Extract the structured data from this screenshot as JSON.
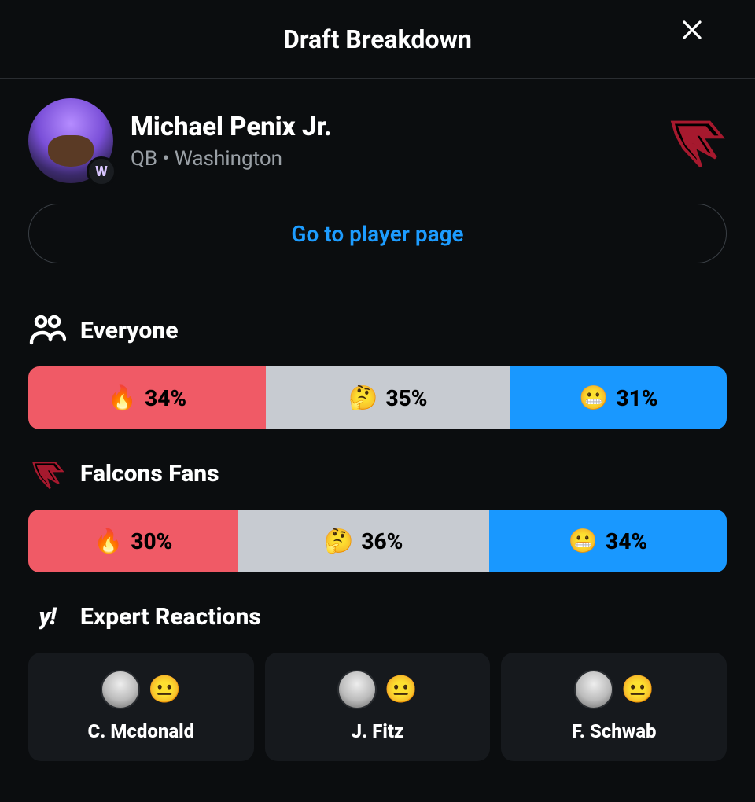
{
  "header": {
    "title": "Draft Breakdown"
  },
  "player": {
    "name": "Michael Penix Jr.",
    "subtitle": "QB • Washington",
    "college_badge": "W",
    "page_button": "Go to player page"
  },
  "polls": {
    "everyone_label": "Everyone",
    "everyone": {
      "hot": "34%",
      "mid": "35%",
      "cold": "31%"
    },
    "fans_label": "Falcons Fans",
    "fans": {
      "hot": "30%",
      "mid": "36%",
      "cold": "34%"
    },
    "emojis": {
      "hot": "🔥",
      "mid": "🤔",
      "cold": "😬"
    }
  },
  "experts": {
    "label": "Expert Reactions",
    "brand_mark": "y!",
    "items": [
      {
        "name": "C. Mcdonald",
        "reaction": "😐"
      },
      {
        "name": "J. Fitz",
        "reaction": "😐"
      },
      {
        "name": "F. Schwab",
        "reaction": "😐"
      }
    ]
  }
}
